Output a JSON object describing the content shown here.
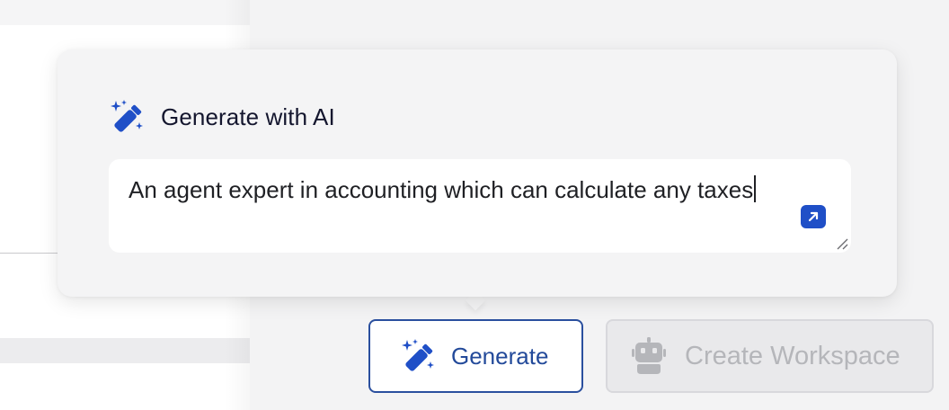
{
  "popover": {
    "title": "Generate with AI",
    "title_icon": "magic-wand-icon",
    "prompt_value": "An agent expert in accounting which can calculate any taxes",
    "expand_icon": "arrow-up-right-icon",
    "resize_icon": "resize-handle-icon"
  },
  "actions": {
    "generate_label": "Generate",
    "generate_icon": "magic-wand-icon",
    "create_workspace_label": "Create Workspace",
    "create_workspace_icon": "robot-icon",
    "create_workspace_disabled": true
  },
  "colors": {
    "accent": "#1f4fc7",
    "generate_border": "#2a4f9e",
    "title_text": "#14162e",
    "disabled_text": "#b5b6ba",
    "popover_bg": "#f4f4f5"
  }
}
